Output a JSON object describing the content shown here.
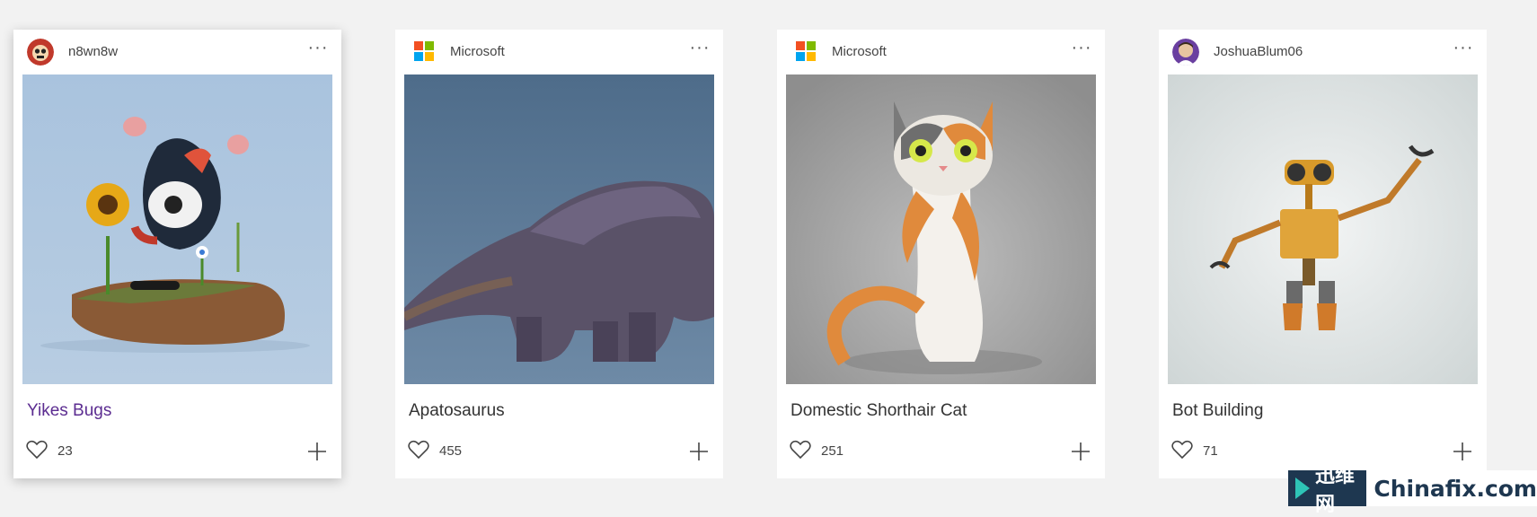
{
  "cards": [
    {
      "author": "n8wn8w",
      "title": "Yikes Bugs",
      "likes": "23",
      "more": "···"
    },
    {
      "author": "Microsoft",
      "title": "Apatosaurus",
      "likes": "455",
      "more": "···"
    },
    {
      "author": "Microsoft",
      "title": "Domestic Shorthair Cat",
      "likes": "251",
      "more": "···"
    },
    {
      "author": "JoshuaBlum06",
      "title": "Bot Building",
      "likes": "71",
      "more": "···"
    }
  ],
  "watermark": {
    "brand": "迅维网",
    "site": "Chinafix.com"
  },
  "colors": {
    "visited_title": "#5c2d91",
    "ms_red": "#f25022",
    "ms_green": "#7fba00",
    "ms_blue": "#00a4ef",
    "ms_yellow": "#ffb900"
  }
}
